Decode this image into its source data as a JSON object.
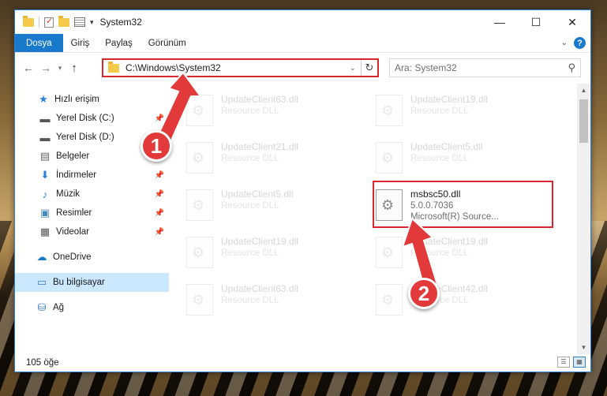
{
  "window": {
    "title": "System32",
    "controls": {
      "minimize": "—",
      "maximize": "☐",
      "close": "✕"
    }
  },
  "ribbon": {
    "tabs": [
      {
        "label": "Dosya",
        "active": true
      },
      {
        "label": "Giriş"
      },
      {
        "label": "Paylaş"
      },
      {
        "label": "Görünüm"
      }
    ],
    "help": "?"
  },
  "nav": {
    "address": "C:\\Windows\\System32",
    "search_placeholder": "Ara: System32"
  },
  "sidebar": {
    "quick_access": "Hızlı erişim",
    "items": [
      {
        "label": "Yerel Disk (C:)",
        "icon": "drive-icon",
        "pinned": true
      },
      {
        "label": "Yerel Disk (D:)",
        "icon": "drive-icon",
        "pinned": false
      },
      {
        "label": "Belgeler",
        "icon": "documents-icon",
        "pinned": true
      },
      {
        "label": "İndirmeler",
        "icon": "downloads-icon",
        "pinned": true
      },
      {
        "label": "Müzik",
        "icon": "music-icon",
        "pinned": true
      },
      {
        "label": "Resimler",
        "icon": "pictures-icon",
        "pinned": true
      },
      {
        "label": "Videolar",
        "icon": "videos-icon",
        "pinned": true
      }
    ],
    "onedrive": "OneDrive",
    "this_pc": "Bu bilgisayar",
    "network": "Ağ"
  },
  "files": [
    {
      "name": "UpdateClient63.dll",
      "meta": "Resource DLL",
      "faded": true
    },
    {
      "name": "UpdateClient19.dll",
      "meta": "Resource DLL",
      "faded": true
    },
    {
      "name": "UpdateClient21.dll",
      "meta": "Resource DLL",
      "faded": true
    },
    {
      "name": "UpdateClient5.dll",
      "meta": "Resource DLL",
      "faded": true
    },
    {
      "name": "UpdateClient5.dll",
      "meta": "Resource DLL",
      "faded": true
    },
    {
      "name": "msbsc50.dll",
      "version": "5.0.0.7036",
      "meta": "Microsoft(R) Source...",
      "faded": false
    },
    {
      "name": "UpdateClient19.dll",
      "meta": "Resource DLL",
      "faded": true
    },
    {
      "name": "UpdateClient19.dll",
      "meta": "Resource DLL",
      "faded": true
    },
    {
      "name": "UpdateClient63.dll",
      "meta": "Resource DLL",
      "faded": true
    },
    {
      "name": "UpdateClient42.dll",
      "meta": "Resource DLL",
      "faded": true
    }
  ],
  "status": {
    "count": "105 öğe"
  },
  "callouts": {
    "one": "1",
    "two": "2",
    "color": "#e23a3a"
  }
}
